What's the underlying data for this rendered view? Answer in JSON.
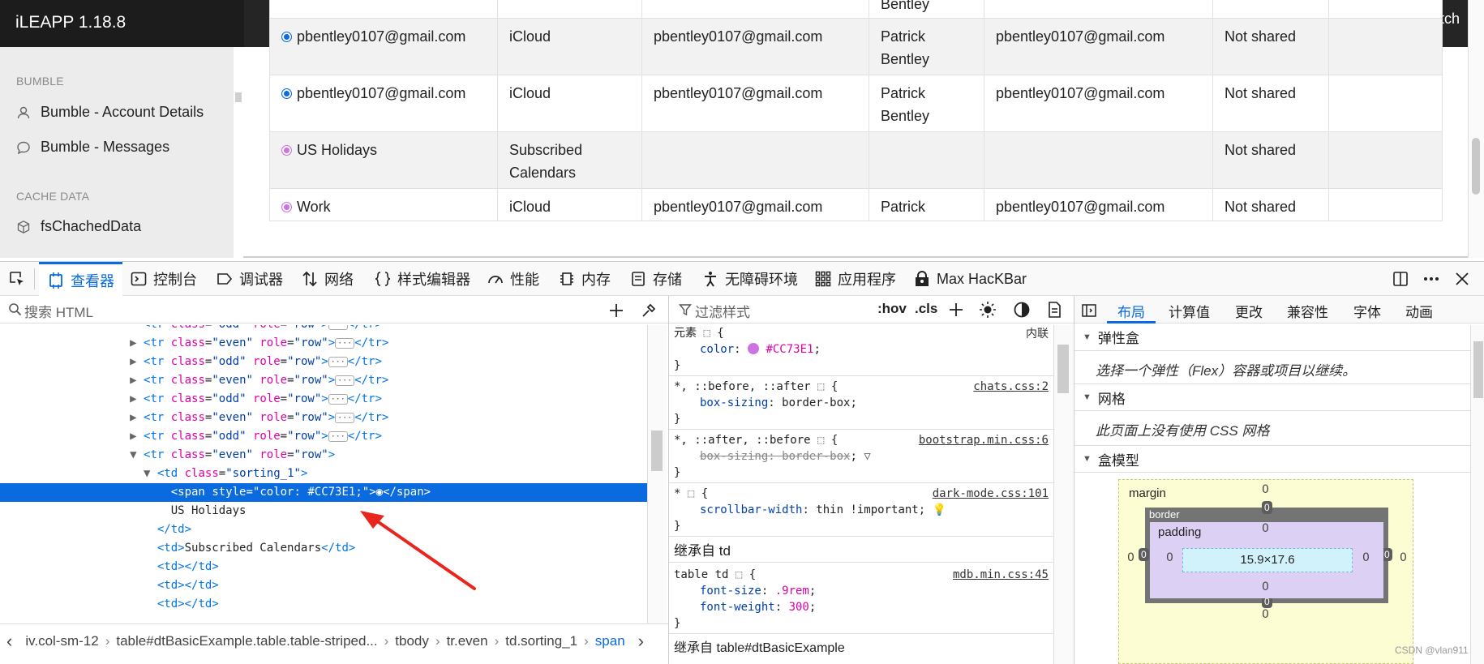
{
  "app": {
    "brand": "iLEAPP 1.18.8",
    "dark_switch_label": "Dark Switch"
  },
  "sidebar": {
    "sections": [
      {
        "title": "BUMBLE",
        "items": [
          {
            "label": "Bumble - Account Details",
            "icon": "user-icon"
          },
          {
            "label": "Bumble - Messages",
            "icon": "chat-bubble-icon"
          }
        ]
      },
      {
        "title": "CACHE DATA",
        "items": [
          {
            "label": "fsChachedData",
            "icon": "box-icon"
          }
        ]
      }
    ]
  },
  "table": {
    "rows": [
      {
        "dot_color": "",
        "cells": [
          "",
          "",
          "",
          "Bentley",
          "",
          "",
          ""
        ]
      },
      {
        "dot_color": "#0a6ae0",
        "cells": [
          "pbentley0107@gmail.com",
          "iCloud",
          "pbentley0107@gmail.com",
          "Patrick Bentley",
          "pbentley0107@gmail.com",
          "Not shared",
          ""
        ]
      },
      {
        "dot_color": "#0a6ae0",
        "cells": [
          "pbentley0107@gmail.com",
          "iCloud",
          "pbentley0107@gmail.com",
          "Patrick Bentley",
          "pbentley0107@gmail.com",
          "Not shared",
          ""
        ]
      },
      {
        "dot_color": "#CC73E1",
        "cells": [
          "US Holidays",
          "Subscribed Calendars",
          "",
          "",
          "",
          "Not shared",
          ""
        ]
      },
      {
        "dot_color": "#CC73E1",
        "cells": [
          "Work",
          "iCloud",
          "pbentley0107@gmail.com",
          "Patrick",
          "pbentley0107@gmail.com",
          "Not shared",
          ""
        ]
      }
    ]
  },
  "devtools": {
    "tools": [
      {
        "label": "",
        "icon": "pick-element-icon"
      },
      {
        "label": "查看器",
        "icon": "inspector-icon"
      },
      {
        "label": "控制台",
        "icon": "console-icon"
      },
      {
        "label": "调试器",
        "icon": "debugger-icon"
      },
      {
        "label": "网络",
        "icon": "network-icon"
      },
      {
        "label": "样式编辑器",
        "icon": "style-editor-icon"
      },
      {
        "label": "性能",
        "icon": "performance-icon"
      },
      {
        "label": "内存",
        "icon": "memory-icon"
      },
      {
        "label": "存储",
        "icon": "storage-icon"
      },
      {
        "label": "无障碍环境",
        "icon": "accessibility-icon"
      },
      {
        "label": "应用程序",
        "icon": "application-icon"
      },
      {
        "label": "Max HacKBar",
        "icon": "hackbar-icon"
      }
    ],
    "search_placeholder": "搜索 HTML",
    "markup": [
      {
        "text": "<tr class=\"odd\" role=\"row\">",
        "partial": true
      },
      {
        "tag": "tr",
        "cls": "even",
        "collapsed": true
      },
      {
        "tag": "tr",
        "cls": "odd",
        "collapsed": true
      },
      {
        "tag": "tr",
        "cls": "even",
        "collapsed": true
      },
      {
        "tag": "tr",
        "cls": "odd",
        "collapsed": true
      },
      {
        "tag": "tr",
        "cls": "even",
        "collapsed": true
      },
      {
        "tag": "tr",
        "cls": "odd",
        "collapsed": true
      },
      {
        "tag": "tr",
        "cls": "even",
        "collapsed": false
      },
      {
        "td_open": "sorting_1"
      },
      {
        "span_line": "<span style=\"color: #CC73E1;\">◉</span>"
      },
      {
        "text_line": "US Holidays"
      },
      {
        "close": "</td>"
      },
      {
        "td_text": "Subscribed Calendars"
      },
      {
        "empty_td": true
      },
      {
        "empty_td": true
      },
      {
        "empty_td": true
      }
    ],
    "breadcrumbs": [
      "iv.col-sm-12",
      "table#dtBasicExample.table.table-striped...",
      "tbody",
      "tr.even",
      "td.sorting_1",
      "span"
    ],
    "rules": {
      "filter_placeholder": "过滤样式",
      "buttons": [
        ":hov",
        ".cls"
      ],
      "element_label": "元素",
      "element_rule": {
        "prop": "color",
        "value": "#CC73E1",
        "inline_label": "内联"
      },
      "rule2": {
        "selector": "*, ::before, ::after",
        "source": "chats.css:2",
        "prop": "box-sizing",
        "value": "border-box"
      },
      "rule3": {
        "selector": "*, ::after, ::before",
        "source": "bootstrap.min.css:6",
        "prop": "box-sizing",
        "value": "border-box"
      },
      "rule4": {
        "selector": "*",
        "source": "dark-mode.css:101",
        "prop": "scrollbar-width",
        "value": "thin !important"
      },
      "inherited_label": "继承自 td",
      "rule5": {
        "selector": "table td",
        "source": "mdb.min.css:45",
        "props": [
          {
            "prop": "font-size",
            "value": ".9rem"
          },
          {
            "prop": "font-weight",
            "value": "300"
          }
        ]
      },
      "next_label": "继承自 table#dtBasicExample"
    },
    "layout": {
      "tabs": [
        "布局",
        "计算值",
        "更改",
        "兼容性",
        "字体",
        "动画"
      ],
      "flexbox_title": "弹性盒",
      "flexbox_text": "选择一个弹性（Flex）容器或项目以继续。",
      "grid_title": "网格",
      "grid_text": "此页面上没有使用 CSS 网格",
      "boxmodel_title": "盒模型",
      "boxmodel": {
        "margin_label": "margin",
        "border_label": "border",
        "padding_label": "padding",
        "content_size": "15.9×17.6",
        "zero": "0"
      }
    }
  },
  "watermark": "CSDN @vlan911"
}
